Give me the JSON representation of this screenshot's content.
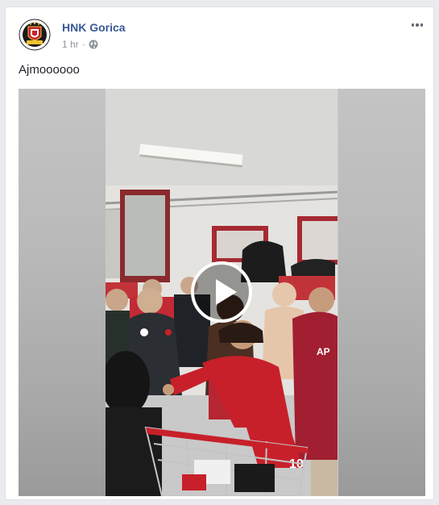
{
  "post": {
    "page_name": "HNK Gorica",
    "timestamp": "1 hr",
    "separator": "·",
    "privacy_icon": "globe-icon",
    "text": "Ajmoooooo",
    "more_icon": "more-options-icon"
  },
  "logo": {
    "text": "HNK GORICA"
  },
  "video": {
    "jersey_number": "10",
    "play_icon": "play-icon"
  },
  "colors": {
    "link": "#385898",
    "meta": "#90949c",
    "jersey_red": "#c8202a"
  }
}
